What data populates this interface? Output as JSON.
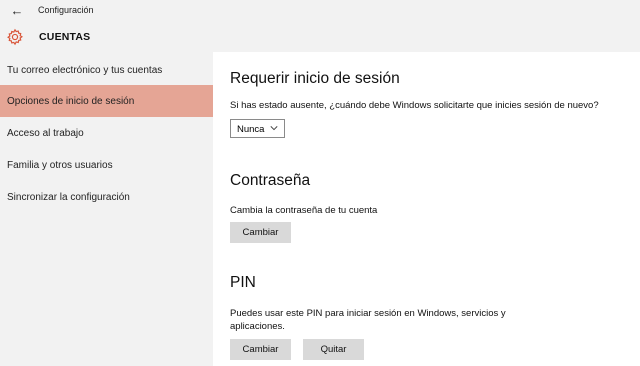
{
  "window": {
    "title": "Configuración",
    "section": "CUENTAS"
  },
  "sidebar": {
    "items": [
      {
        "label": "Tu correo electrónico y tus cuentas"
      },
      {
        "label": "Opciones de inicio de sesión"
      },
      {
        "label": "Acceso al trabajo"
      },
      {
        "label": "Familia y otros usuarios"
      },
      {
        "label": "Sincronizar la configuración"
      }
    ],
    "active_index": 1
  },
  "main": {
    "require_signin": {
      "heading": "Requerir inicio de sesión",
      "question": "Si has estado ausente, ¿cuándo debe Windows solicitarte que inicies sesión de nuevo?",
      "select_value": "Nunca"
    },
    "password": {
      "heading": "Contraseña",
      "description": "Cambia la contraseña de tu cuenta",
      "change_label": "Cambiar"
    },
    "pin": {
      "heading": "PIN",
      "description": "Puedes usar este PIN para iniciar sesión en Windows, servicios y aplicaciones.",
      "change_label": "Cambiar",
      "remove_label": "Quitar"
    }
  },
  "colors": {
    "accent": "#e5a595",
    "icon": "#d9563a",
    "panel": "#f2f2f2",
    "button": "#d9d9d9"
  }
}
